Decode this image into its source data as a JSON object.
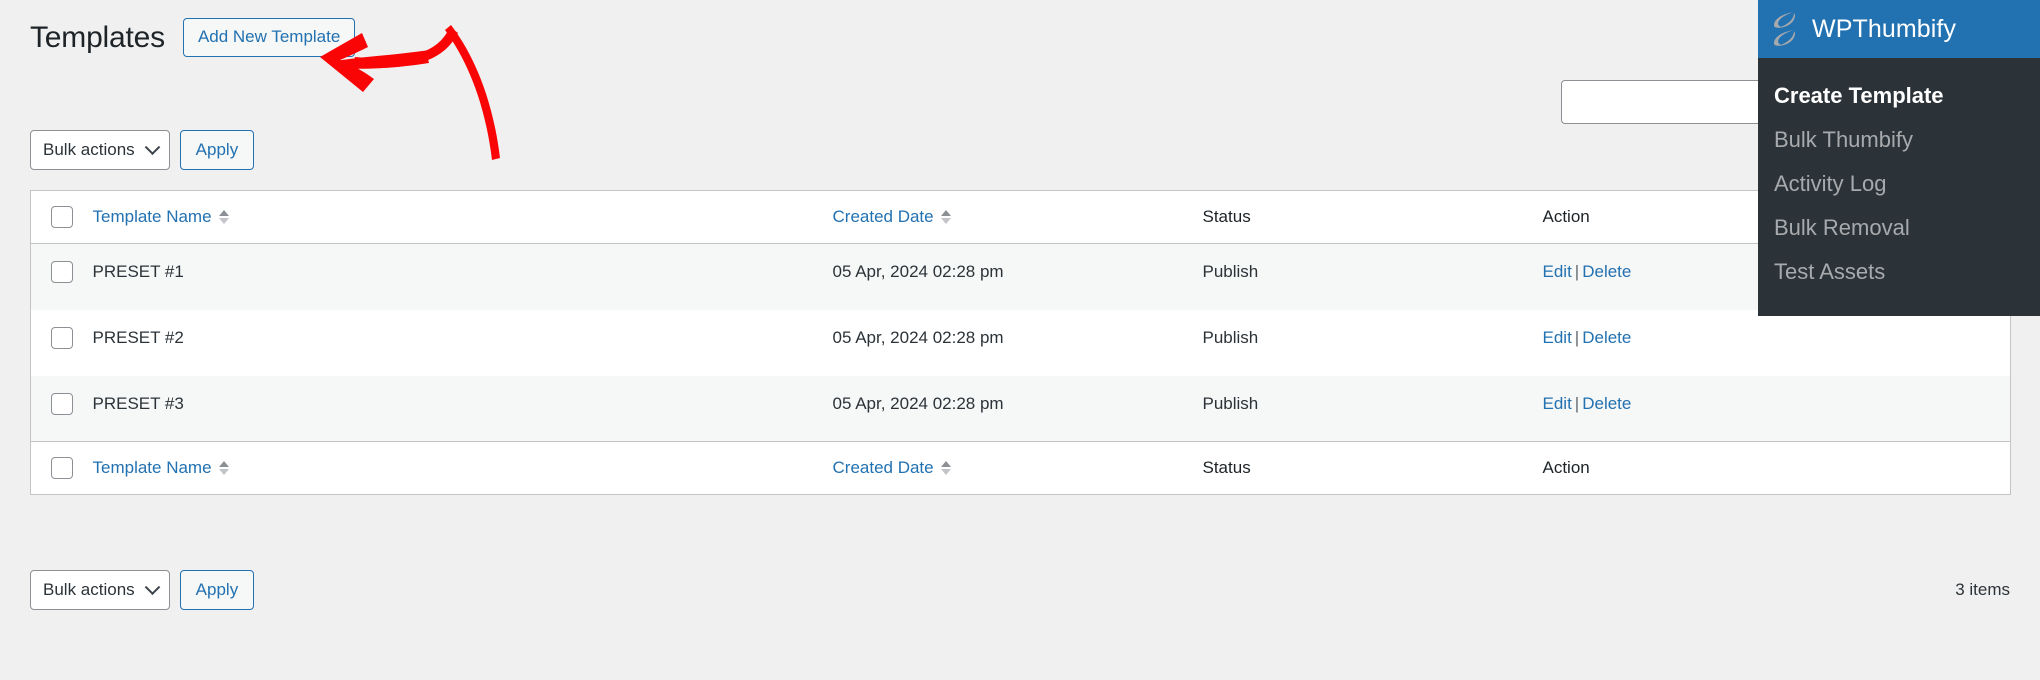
{
  "page": {
    "title": "Templates",
    "add_button": "Add New Template"
  },
  "search": {
    "value": "",
    "placeholder": ""
  },
  "tablenav_top": {
    "bulk_select": "Bulk actions",
    "apply_label": "Apply"
  },
  "tablenav_bottom": {
    "bulk_select": "Bulk actions",
    "apply_label": "Apply",
    "items_count": "3 items"
  },
  "table": {
    "columns": {
      "template_name": "Template Name",
      "created_date": "Created Date",
      "status": "Status",
      "action": "Action"
    },
    "rows": [
      {
        "name": "PRESET #1",
        "created": "05 Apr, 2024 02:28 pm",
        "status": "Publish",
        "edit": "Edit",
        "separator": "|",
        "delete": "Delete"
      },
      {
        "name": "PRESET #2",
        "created": "05 Apr, 2024 02:28 pm",
        "status": "Publish",
        "edit": "Edit",
        "separator": "|",
        "delete": "Delete"
      },
      {
        "name": "PRESET #3",
        "created": "05 Apr, 2024 02:28 pm",
        "status": "Publish",
        "edit": "Edit",
        "separator": "|",
        "delete": "Delete"
      }
    ]
  },
  "menu": {
    "brand": "WPThumbify",
    "items": [
      {
        "label": "Create Template",
        "active": true
      },
      {
        "label": "Bulk Thumbify",
        "active": false
      },
      {
        "label": "Activity Log",
        "active": false
      },
      {
        "label": "Bulk Removal",
        "active": false
      },
      {
        "label": "Test Assets",
        "active": false
      }
    ]
  },
  "annotation": {
    "shape": "curved-arrow-pointing-left",
    "color": "#fa0505"
  },
  "colors": {
    "brand_blue": "#2271b1",
    "menu_dark": "#2c3338",
    "page_bg": "#f0f0f1",
    "row_striped": "#f6f7f7",
    "annotation_red": "#fa0505"
  }
}
